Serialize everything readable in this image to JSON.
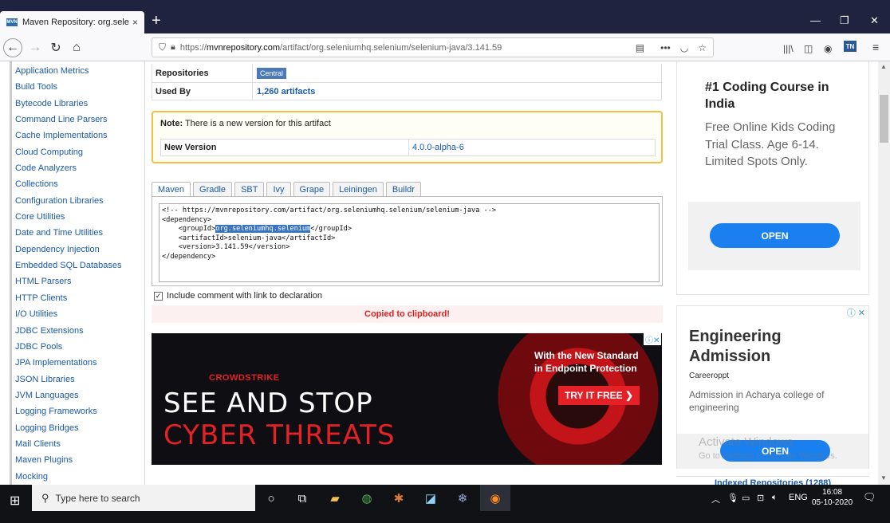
{
  "browser": {
    "tab_title": "Maven Repository: org.selenium",
    "tab_favicon": "MVN",
    "tab_close": "×",
    "new_tab": "+",
    "url_prefix": "https://",
    "url_domain": "mvnrepository.com",
    "url_path": "/artifact/org.seleniumhq.selenium/selenium-java/3.141.59",
    "profile_badge": "TN"
  },
  "sidebar": {
    "items": [
      "Application Metrics",
      "Build Tools",
      "Bytecode Libraries",
      "Command Line Parsers",
      "Cache Implementations",
      "Cloud Computing",
      "Code Analyzers",
      "Collections",
      "Configuration Libraries",
      "Core Utilities",
      "Date and Time Utilities",
      "Dependency Injection",
      "Embedded SQL Databases",
      "HTML Parsers",
      "HTTP Clients",
      "I/O Utilities",
      "JDBC Extensions",
      "JDBC Pools",
      "JPA Implementations",
      "JSON Libraries",
      "JVM Languages",
      "Logging Frameworks",
      "Logging Bridges",
      "Mail Clients",
      "Maven Plugins",
      "Mocking"
    ]
  },
  "artifact": {
    "repositories_label": "Repositories",
    "repositories_value": "Central",
    "usedby_label": "Used By",
    "usedby_value": "1,260 artifacts"
  },
  "note": {
    "prefix": "Note:",
    "text": " There is a new version for this artifact",
    "new_version_label": "New Version",
    "new_version_value": "4.0.0-alpha-6"
  },
  "build_tabs": [
    "Maven",
    "Gradle",
    "SBT",
    "Ivy",
    "Grape",
    "Leiningen",
    "Buildr"
  ],
  "code": {
    "line1": "<!-- https://mvnrepository.com/artifact/org.seleniumhq.selenium/selenium-java -->",
    "line2": "<dependency>",
    "line3_pre": "    <groupId>",
    "line3_sel": "org.seleniumhq.selenium",
    "line3_post": "</groupId>",
    "line4": "    <artifactId>selenium-java</artifactId>",
    "line5": "    <version>3.141.59</version>",
    "line6": "</dependency>"
  },
  "include_comment": {
    "label": "Include comment with link to declaration",
    "checked": true
  },
  "copied_message": "Copied to clipboard!",
  "banner_ad": {
    "logo": "CROWDSTRIKE",
    "headline1": "SEE AND STOP",
    "headline2": "CYBER THREATS",
    "tagline1": "With the New Standard",
    "tagline2": "in Endpoint Protection",
    "cta": "TRY IT FREE ❯"
  },
  "right_ad1": {
    "title1": "#1 Coding Course in",
    "title2": "India",
    "desc1": "Free Online Kids Coding",
    "desc2": "Trial Class. Age 6-14.",
    "desc3": "Limited Spots Only.",
    "cta": "OPEN"
  },
  "right_ad2": {
    "title1": "Engineering",
    "title2": "Admission",
    "source": "Careeroppt",
    "desc": "Admission in Acharya college of engineering",
    "cta": "OPEN"
  },
  "watermark": {
    "line1": "Activate Windows",
    "line2": "Go to Settings to activate Windows."
  },
  "indexed_repos": "Indexed Repositories (1288)",
  "taskbar": {
    "search_placeholder": "Type here to search",
    "lang": "ENG",
    "time": "16:08",
    "date": "05-10-2020"
  },
  "colors": {
    "link": "#1a5aab",
    "tabbar": "#202340",
    "highlight": "#3a75c4",
    "alert": "#e02020",
    "note_border": "#f0c040",
    "ad_button": "#1a80f0"
  }
}
